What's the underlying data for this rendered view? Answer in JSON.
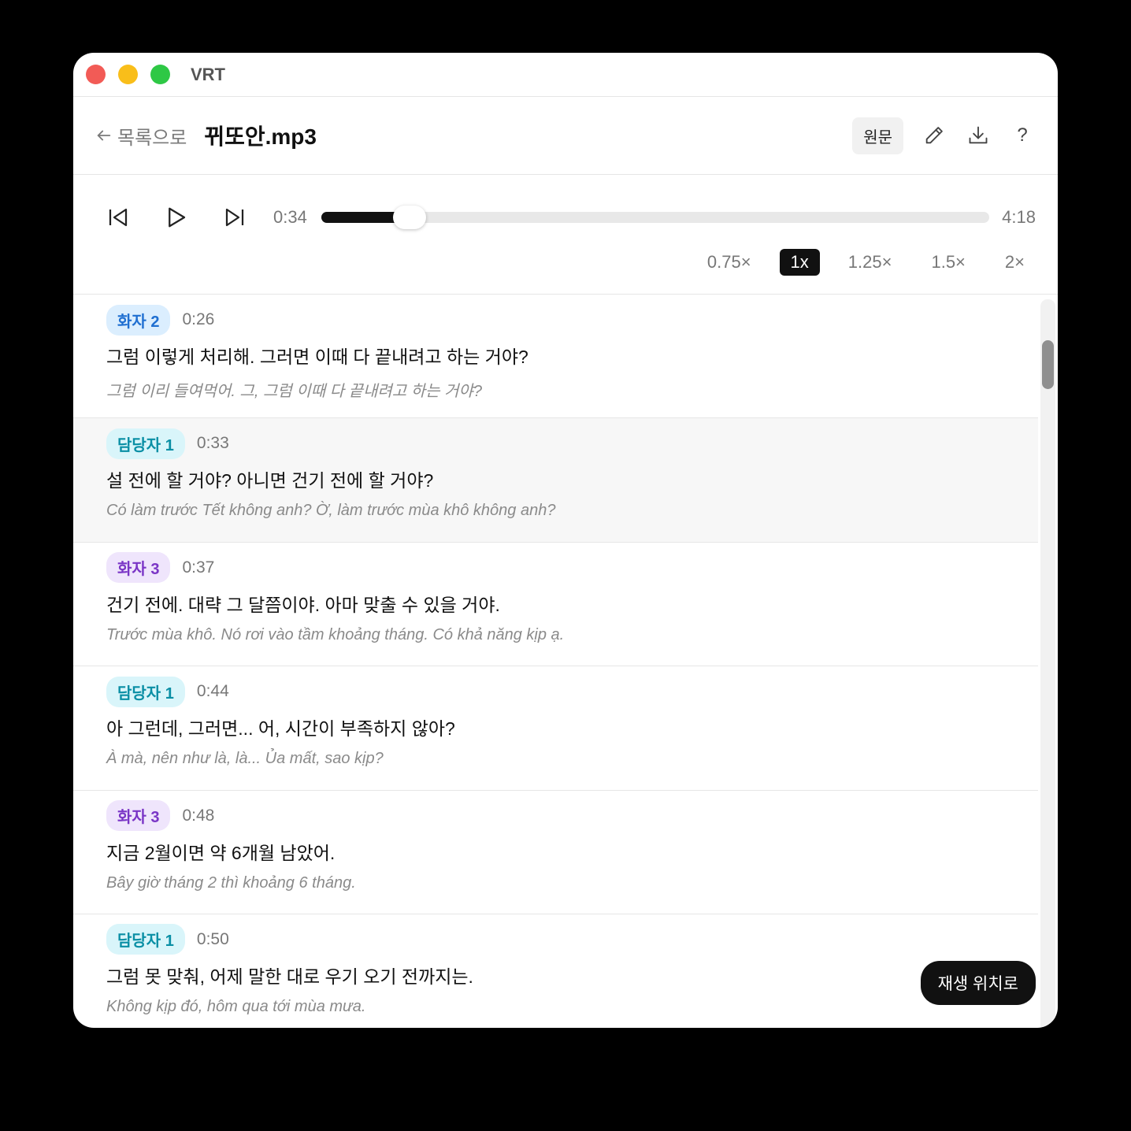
{
  "window": {
    "title": "VRT"
  },
  "header": {
    "back_label": "목록으로",
    "file_title": "뀌또안.mp3",
    "original_label": "원문",
    "help_label": "?"
  },
  "player": {
    "current_time": "0:34",
    "total_time": "4:18",
    "progress": 0.1318,
    "speeds": [
      "0.75×",
      "1x",
      "1.25×",
      "1.5×",
      "2×"
    ],
    "active_speed": "1x"
  },
  "segments": [
    {
      "speaker": "화자 2",
      "badge_color": "blue",
      "time": "0:26",
      "text": "그럼 이렇게 처리해. 그러면 이때 다 끝내려고 하는 거야?",
      "translation": "그럼 이리 들여먹어. 그, 그럼 이때 다 끝내려고 하는 거야?",
      "highlighted": false
    },
    {
      "speaker": "담당자 1",
      "badge_color": "cyan",
      "time": "0:33",
      "text": "설 전에 할 거야? 아니면 건기 전에 할 거야?",
      "translation": "Có làm trước Tết không anh? Ờ, làm trước mùa khô không anh?",
      "highlighted": true
    },
    {
      "speaker": "화자 3",
      "badge_color": "purple",
      "time": "0:37",
      "text": "건기 전에. 대략 그 달쯤이야. 아마 맞출 수 있을 거야.",
      "translation": "Trước mùa khô. Nó rơi vào tầm khoảng tháng. Có khả năng kịp ạ.",
      "highlighted": false
    },
    {
      "speaker": "담당자 1",
      "badge_color": "cyan",
      "time": "0:44",
      "text": "아 그런데, 그러면... 어, 시간이 부족하지 않아?",
      "translation": "À mà, nên như là, là... Ủa mất, sao kịp?",
      "highlighted": false
    },
    {
      "speaker": "화자 3",
      "badge_color": "purple",
      "time": "0:48",
      "text": "지금 2월이면 약 6개월 남았어.",
      "translation": "Bây giờ tháng 2 thì khoảng 6 tháng.",
      "highlighted": false
    },
    {
      "speaker": "담당자 1",
      "badge_color": "cyan",
      "time": "0:50",
      "text": "그럼 못 맞춰, 어제 말한 대로 우기 오기 전까지는.",
      "translation": "Không kịp đó, hôm qua tới mùa mưa.",
      "highlighted": false
    }
  ],
  "jump_button_label": "재생 위치로",
  "colors": {
    "close": "#f25b56",
    "minimize": "#f9be1a",
    "maximize": "#2ec845",
    "badge_blue": "#1f6fd1",
    "badge_cyan": "#0a8fa5",
    "badge_purple": "#7a35c6"
  }
}
